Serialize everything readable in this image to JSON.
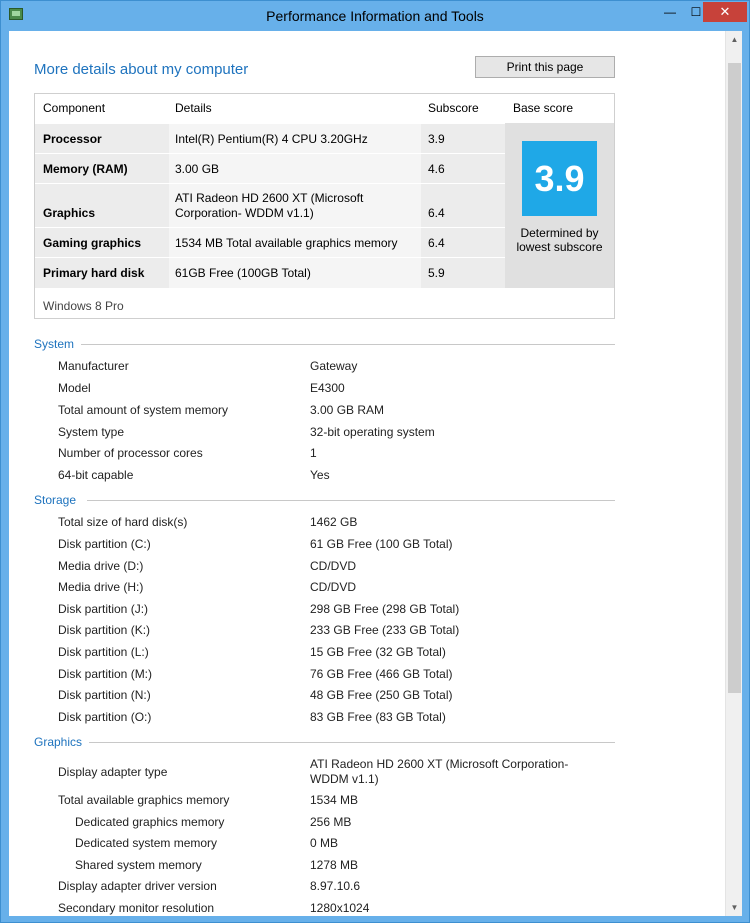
{
  "window": {
    "title": "Performance Information and Tools",
    "minimize_glyph": "—",
    "maximize_glyph": "☐",
    "close_glyph": "✕"
  },
  "header": {
    "page_title": "More details about my computer",
    "print_label": "Print this page"
  },
  "score_table": {
    "headers": {
      "component": "Component",
      "details": "Details",
      "subscore": "Subscore",
      "base": "Base score"
    },
    "rows": [
      {
        "component": "Processor",
        "details": "Intel(R) Pentium(R) 4 CPU 3.20GHz",
        "subscore": "3.9"
      },
      {
        "component": "Memory (RAM)",
        "details": "3.00 GB",
        "subscore": "4.6"
      },
      {
        "component": "Graphics",
        "details": "ATI Radeon HD 2600 XT (Microsoft Corporation- WDDM v1.1)",
        "subscore": "6.4"
      },
      {
        "component": "Gaming graphics",
        "details": "1534 MB Total available graphics memory",
        "subscore": "6.4"
      },
      {
        "component": "Primary hard disk",
        "details": "61GB Free (100GB Total)",
        "subscore": "5.9"
      }
    ],
    "base_score": "3.9",
    "determined_by": "Determined by lowest subscore",
    "os": "Windows 8 Pro",
    "tile_color": "#1fa8e7"
  },
  "system": {
    "heading": "System",
    "items": [
      {
        "label": "Manufacturer",
        "value": "Gateway"
      },
      {
        "label": "Model",
        "value": "E4300"
      },
      {
        "label": "Total amount of system memory",
        "value": "3.00 GB RAM"
      },
      {
        "label": "System type",
        "value": "32-bit operating system"
      },
      {
        "label": "Number of processor cores",
        "value": "1"
      },
      {
        "label": "64-bit capable",
        "value": "Yes"
      }
    ]
  },
  "storage": {
    "heading": "Storage",
    "items": [
      {
        "label": "Total size of hard disk(s)",
        "value": "1462 GB"
      },
      {
        "label": "Disk partition (C:)",
        "value": "61 GB Free (100 GB Total)"
      },
      {
        "label": "Media drive (D:)",
        "value": "CD/DVD"
      },
      {
        "label": "Media drive (H:)",
        "value": "CD/DVD"
      },
      {
        "label": "Disk partition (J:)",
        "value": "298 GB Free (298 GB Total)"
      },
      {
        "label": "Disk partition (K:)",
        "value": "233 GB Free (233 GB Total)"
      },
      {
        "label": "Disk partition (L:)",
        "value": "15 GB Free (32 GB Total)"
      },
      {
        "label": "Disk partition (M:)",
        "value": "76 GB Free (466 GB Total)"
      },
      {
        "label": "Disk partition (N:)",
        "value": "48 GB Free (250 GB Total)"
      },
      {
        "label": "Disk partition (O:)",
        "value": "83 GB Free (83 GB Total)"
      }
    ]
  },
  "graphics": {
    "heading": "Graphics",
    "items": [
      {
        "label": "Display adapter type",
        "value": "ATI Radeon HD 2600 XT (Microsoft Corporation- WDDM v1.1)"
      },
      {
        "label": "Total available graphics memory",
        "value": "1534 MB"
      },
      {
        "label": "Dedicated graphics memory",
        "value": "256 MB"
      },
      {
        "label": "Dedicated system memory",
        "value": "0 MB"
      },
      {
        "label": "Shared system memory",
        "value": "1278 MB"
      },
      {
        "label": "Display adapter driver version",
        "value": "8.97.10.6"
      },
      {
        "label": "Secondary monitor resolution",
        "value": "1280x1024"
      }
    ]
  },
  "scrollbar": {
    "up_glyph": "▲",
    "down_glyph": "▼"
  }
}
